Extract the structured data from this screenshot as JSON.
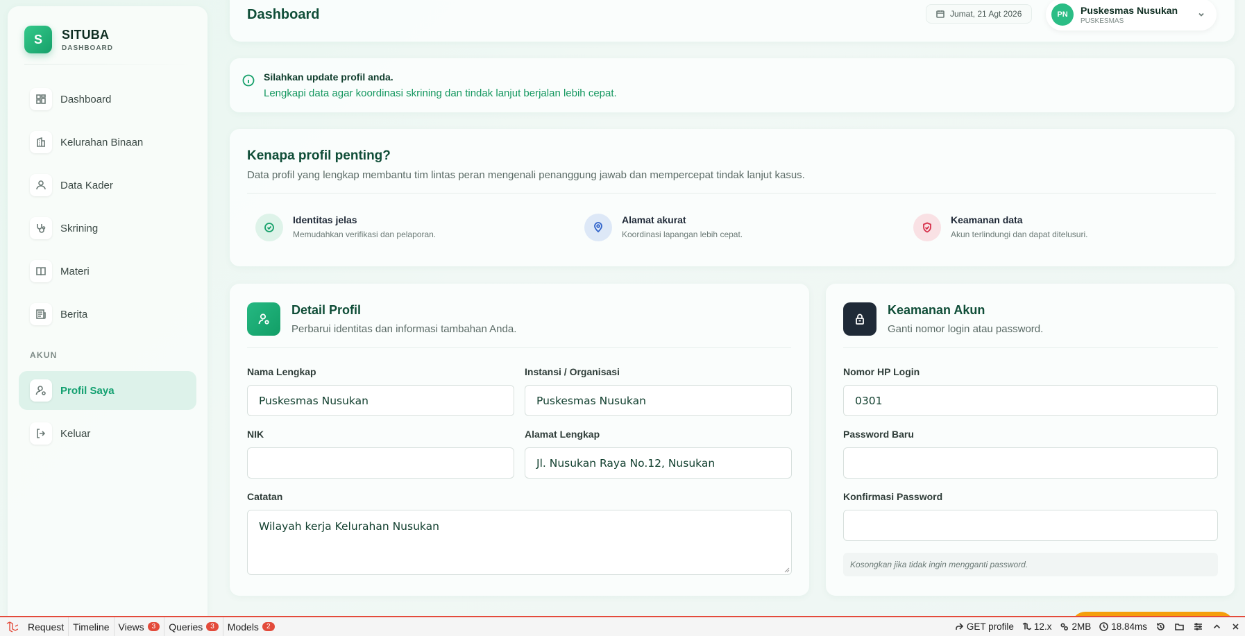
{
  "brand": {
    "logo_letter": "S",
    "name": "SITUBA",
    "subtitle": "DASHBOARD"
  },
  "sidebar": {
    "items": [
      {
        "label": "Dashboard",
        "icon": "grid-icon"
      },
      {
        "label": "Kelurahan Binaan",
        "icon": "building-icon"
      },
      {
        "label": "Data Kader",
        "icon": "user-icon"
      },
      {
        "label": "Skrining",
        "icon": "stethoscope-icon"
      },
      {
        "label": "Materi",
        "icon": "book-icon"
      },
      {
        "label": "Berita",
        "icon": "newspaper-icon"
      }
    ],
    "section_akun": "AKUN",
    "akun_items": [
      {
        "label": "Profil Saya",
        "icon": "user-gear-icon",
        "active": true
      },
      {
        "label": "Keluar",
        "icon": "logout-icon"
      }
    ]
  },
  "header": {
    "title": "Dashboard",
    "date": "Jumat, 21 Agt 2026",
    "user": {
      "initials": "PN",
      "name": "Puskesmas Nusukan",
      "role": "PUSKESMAS"
    }
  },
  "alert": {
    "title": "Silahkan update profil anda.",
    "text": "Lengkapi data agar koordinasi skrining dan tindak lanjut berjalan lebih cepat."
  },
  "why": {
    "title": "Kenapa profil penting?",
    "subtitle": "Data profil yang lengkap membantu tim lintas peran mengenali penanggung jawab dan mempercepat tindak lanjut kasus.",
    "features": [
      {
        "title": "Identitas jelas",
        "desc": "Memudahkan verifikasi dan pelaporan.",
        "icon": "check-circle-icon",
        "color": "#16a06a",
        "bg": "#def3e9"
      },
      {
        "title": "Alamat akurat",
        "desc": "Koordinasi lapangan lebih cepat.",
        "icon": "map-pin-icon",
        "color": "#2f62c9",
        "bg": "#dde8f7"
      },
      {
        "title": "Keamanan data",
        "desc": "Akun terlindungi dan dapat ditelusuri.",
        "icon": "shield-check-icon",
        "color": "#d6304a",
        "bg": "#f9e1e4"
      }
    ]
  },
  "profile": {
    "title": "Detail Profil",
    "subtitle": "Perbarui identitas dan informasi tambahan Anda.",
    "fields": {
      "nama": {
        "label": "Nama Lengkap",
        "value": "Puskesmas Nusukan"
      },
      "instansi": {
        "label": "Instansi / Organisasi",
        "value": "Puskesmas Nusukan"
      },
      "nik": {
        "label": "NIK",
        "value": ""
      },
      "alamat": {
        "label": "Alamat Lengkap",
        "value": "Jl. Nusukan Raya No.12, Nusukan"
      },
      "catatan": {
        "label": "Catatan",
        "value": "Wilayah kerja Kelurahan Nusukan"
      }
    }
  },
  "security": {
    "title": "Keamanan Akun",
    "subtitle": "Ganti nomor login atau password.",
    "fields": {
      "phone": {
        "label": "Nomor HP Login",
        "value": "0301"
      },
      "password": {
        "label": "Password Baru",
        "value": ""
      },
      "confirm": {
        "label": "Konfirmasi Password",
        "value": ""
      }
    },
    "hint": "Kosongkan jika tidak ingin mengganti password."
  },
  "debugbar": {
    "tabs": [
      {
        "label": "Request"
      },
      {
        "label": "Timeline"
      },
      {
        "label": "Views",
        "badge": "3"
      },
      {
        "label": "Queries",
        "badge": "3"
      },
      {
        "label": "Models",
        "badge": "2"
      }
    ],
    "route": "GET profile",
    "version": "12.x",
    "memory": "2MB",
    "time": "18.84ms"
  },
  "colors": {
    "accent": "#16a06a",
    "title_green": "#0f4d37",
    "debug_red": "#e34b3b"
  }
}
